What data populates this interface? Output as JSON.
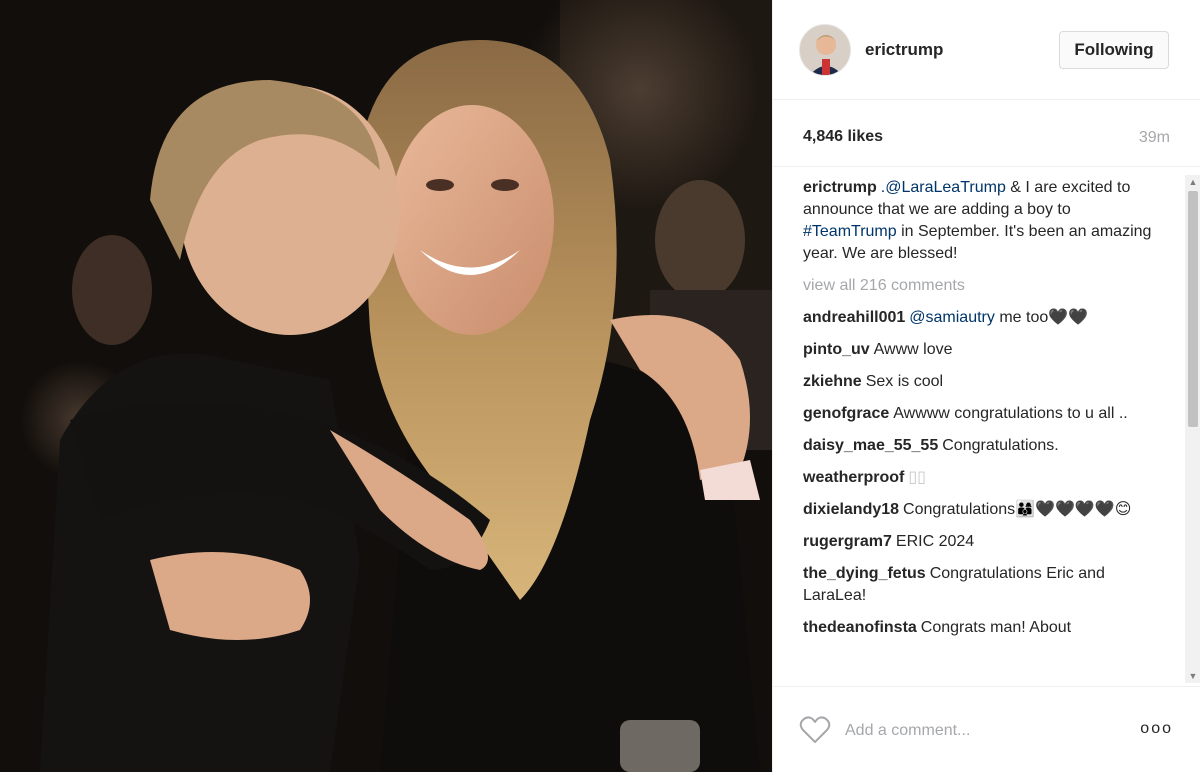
{
  "post": {
    "username": "erictrump",
    "follow_label": "Following",
    "likes": "4,846 likes",
    "time": "39m"
  },
  "caption": {
    "user": "erictrump",
    "mention": ".@LaraLeaTrump",
    "text_a": " & I are excited to announce that we are adding a boy to ",
    "hashtag": "#TeamTrump",
    "text_b": " in September. It's been an amazing year. We are blessed!"
  },
  "view_all": "view all 216 comments",
  "comments": [
    {
      "user": "andreahill001",
      "mention": "@samiautry",
      "text": " me too🖤🖤"
    },
    {
      "user": "pinto_uv",
      "text": "Awww love"
    },
    {
      "user": "zkiehne",
      "text": "Sex is cool"
    },
    {
      "user": "genofgrace",
      "text": "Awwww congratulations to u all .."
    },
    {
      "user": "daisy_mae_55_55",
      "text": "Congratulations."
    },
    {
      "user": "weatherproof",
      "text": "▯▯"
    },
    {
      "user": "dixielandy18",
      "text": "Congratulations👨‍👩‍👦🖤🖤🖤🖤😊"
    },
    {
      "user": "rugergram7",
      "text": "ERIC 2024"
    },
    {
      "user": "the_dying_fetus",
      "text": "Congratulations Eric and LaraLea!"
    },
    {
      "user": "thedeanofinsta",
      "text": "Congrats man! About"
    }
  ],
  "footer": {
    "placeholder": "Add a comment...",
    "more": "ooo"
  },
  "icons": {
    "like": "heart-icon",
    "more": "more-options-icon"
  },
  "colors": {
    "link": "#003569",
    "muted": "#a5a7aa",
    "text": "#262626"
  }
}
